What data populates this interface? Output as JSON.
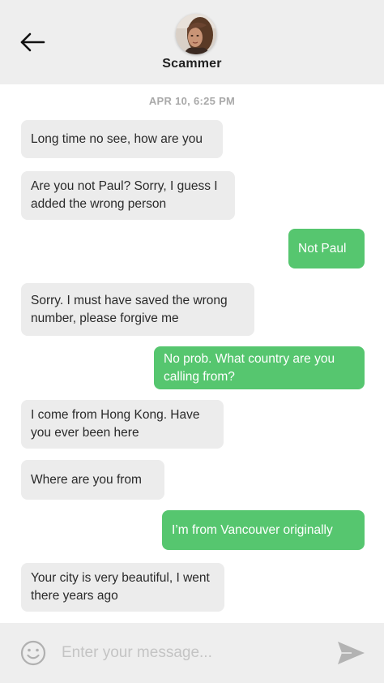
{
  "header": {
    "contact_name": "Scammer"
  },
  "conversation": {
    "timestamp": "APR 10, 6:25 PM"
  },
  "messages": [
    {
      "from": "them",
      "text": "Long time no see, how are you"
    },
    {
      "from": "them",
      "text": "Are you not Paul? Sorry, I guess I added the wrong person"
    },
    {
      "from": "me",
      "text": "Not Paul"
    },
    {
      "from": "them",
      "text": "Sorry. I must have saved the wrong number, please forgive me"
    },
    {
      "from": "me",
      "text": "No prob. What country are you calling from?"
    },
    {
      "from": "them",
      "text": "I come from Hong Kong. Have you ever been here"
    },
    {
      "from": "them",
      "text": "Where are you from"
    },
    {
      "from": "me",
      "text": "I’m from Vancouver originally"
    },
    {
      "from": "them",
      "text": "Your city is very beautiful, I went there years ago"
    }
  ],
  "composer": {
    "input_placeholder": "Enter your message...",
    "input_value": ""
  },
  "icons": {
    "back": "back-arrow-icon",
    "emoji": "smiley-icon",
    "send": "send-icon"
  },
  "colors": {
    "header_bg": "#eeeeee",
    "incoming_bubble": "#ececec",
    "outgoing_bubble": "#56c66f",
    "timestamp_text": "#a9a9a9",
    "icon_gray": "#b0b0b0"
  }
}
